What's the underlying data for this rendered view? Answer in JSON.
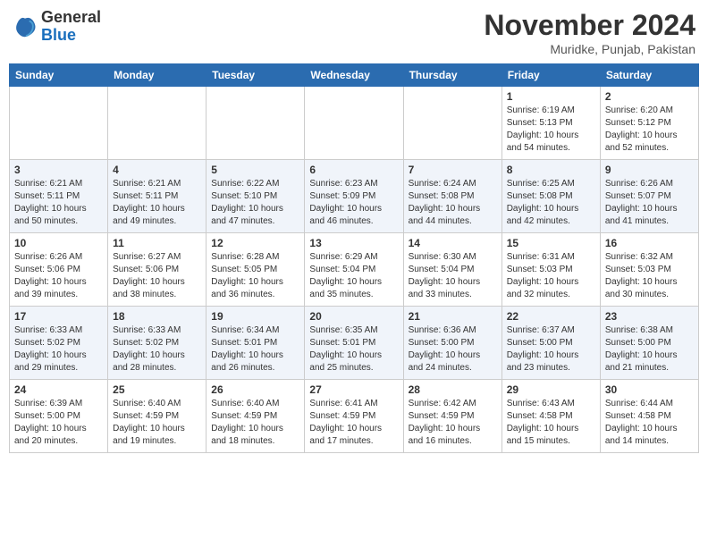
{
  "header": {
    "logo_general": "General",
    "logo_blue": "Blue",
    "month_title": "November 2024",
    "location": "Muridke, Punjab, Pakistan"
  },
  "days_of_week": [
    "Sunday",
    "Monday",
    "Tuesday",
    "Wednesday",
    "Thursday",
    "Friday",
    "Saturday"
  ],
  "weeks": [
    [
      {
        "day": "",
        "info": ""
      },
      {
        "day": "",
        "info": ""
      },
      {
        "day": "",
        "info": ""
      },
      {
        "day": "",
        "info": ""
      },
      {
        "day": "",
        "info": ""
      },
      {
        "day": "1",
        "info": "Sunrise: 6:19 AM\nSunset: 5:13 PM\nDaylight: 10 hours\nand 54 minutes."
      },
      {
        "day": "2",
        "info": "Sunrise: 6:20 AM\nSunset: 5:12 PM\nDaylight: 10 hours\nand 52 minutes."
      }
    ],
    [
      {
        "day": "3",
        "info": "Sunrise: 6:21 AM\nSunset: 5:11 PM\nDaylight: 10 hours\nand 50 minutes."
      },
      {
        "day": "4",
        "info": "Sunrise: 6:21 AM\nSunset: 5:11 PM\nDaylight: 10 hours\nand 49 minutes."
      },
      {
        "day": "5",
        "info": "Sunrise: 6:22 AM\nSunset: 5:10 PM\nDaylight: 10 hours\nand 47 minutes."
      },
      {
        "day": "6",
        "info": "Sunrise: 6:23 AM\nSunset: 5:09 PM\nDaylight: 10 hours\nand 46 minutes."
      },
      {
        "day": "7",
        "info": "Sunrise: 6:24 AM\nSunset: 5:08 PM\nDaylight: 10 hours\nand 44 minutes."
      },
      {
        "day": "8",
        "info": "Sunrise: 6:25 AM\nSunset: 5:08 PM\nDaylight: 10 hours\nand 42 minutes."
      },
      {
        "day": "9",
        "info": "Sunrise: 6:26 AM\nSunset: 5:07 PM\nDaylight: 10 hours\nand 41 minutes."
      }
    ],
    [
      {
        "day": "10",
        "info": "Sunrise: 6:26 AM\nSunset: 5:06 PM\nDaylight: 10 hours\nand 39 minutes."
      },
      {
        "day": "11",
        "info": "Sunrise: 6:27 AM\nSunset: 5:06 PM\nDaylight: 10 hours\nand 38 minutes."
      },
      {
        "day": "12",
        "info": "Sunrise: 6:28 AM\nSunset: 5:05 PM\nDaylight: 10 hours\nand 36 minutes."
      },
      {
        "day": "13",
        "info": "Sunrise: 6:29 AM\nSunset: 5:04 PM\nDaylight: 10 hours\nand 35 minutes."
      },
      {
        "day": "14",
        "info": "Sunrise: 6:30 AM\nSunset: 5:04 PM\nDaylight: 10 hours\nand 33 minutes."
      },
      {
        "day": "15",
        "info": "Sunrise: 6:31 AM\nSunset: 5:03 PM\nDaylight: 10 hours\nand 32 minutes."
      },
      {
        "day": "16",
        "info": "Sunrise: 6:32 AM\nSunset: 5:03 PM\nDaylight: 10 hours\nand 30 minutes."
      }
    ],
    [
      {
        "day": "17",
        "info": "Sunrise: 6:33 AM\nSunset: 5:02 PM\nDaylight: 10 hours\nand 29 minutes."
      },
      {
        "day": "18",
        "info": "Sunrise: 6:33 AM\nSunset: 5:02 PM\nDaylight: 10 hours\nand 28 minutes."
      },
      {
        "day": "19",
        "info": "Sunrise: 6:34 AM\nSunset: 5:01 PM\nDaylight: 10 hours\nand 26 minutes."
      },
      {
        "day": "20",
        "info": "Sunrise: 6:35 AM\nSunset: 5:01 PM\nDaylight: 10 hours\nand 25 minutes."
      },
      {
        "day": "21",
        "info": "Sunrise: 6:36 AM\nSunset: 5:00 PM\nDaylight: 10 hours\nand 24 minutes."
      },
      {
        "day": "22",
        "info": "Sunrise: 6:37 AM\nSunset: 5:00 PM\nDaylight: 10 hours\nand 23 minutes."
      },
      {
        "day": "23",
        "info": "Sunrise: 6:38 AM\nSunset: 5:00 PM\nDaylight: 10 hours\nand 21 minutes."
      }
    ],
    [
      {
        "day": "24",
        "info": "Sunrise: 6:39 AM\nSunset: 5:00 PM\nDaylight: 10 hours\nand 20 minutes."
      },
      {
        "day": "25",
        "info": "Sunrise: 6:40 AM\nSunset: 4:59 PM\nDaylight: 10 hours\nand 19 minutes."
      },
      {
        "day": "26",
        "info": "Sunrise: 6:40 AM\nSunset: 4:59 PM\nDaylight: 10 hours\nand 18 minutes."
      },
      {
        "day": "27",
        "info": "Sunrise: 6:41 AM\nSunset: 4:59 PM\nDaylight: 10 hours\nand 17 minutes."
      },
      {
        "day": "28",
        "info": "Sunrise: 6:42 AM\nSunset: 4:59 PM\nDaylight: 10 hours\nand 16 minutes."
      },
      {
        "day": "29",
        "info": "Sunrise: 6:43 AM\nSunset: 4:58 PM\nDaylight: 10 hours\nand 15 minutes."
      },
      {
        "day": "30",
        "info": "Sunrise: 6:44 AM\nSunset: 4:58 PM\nDaylight: 10 hours\nand 14 minutes."
      }
    ]
  ]
}
